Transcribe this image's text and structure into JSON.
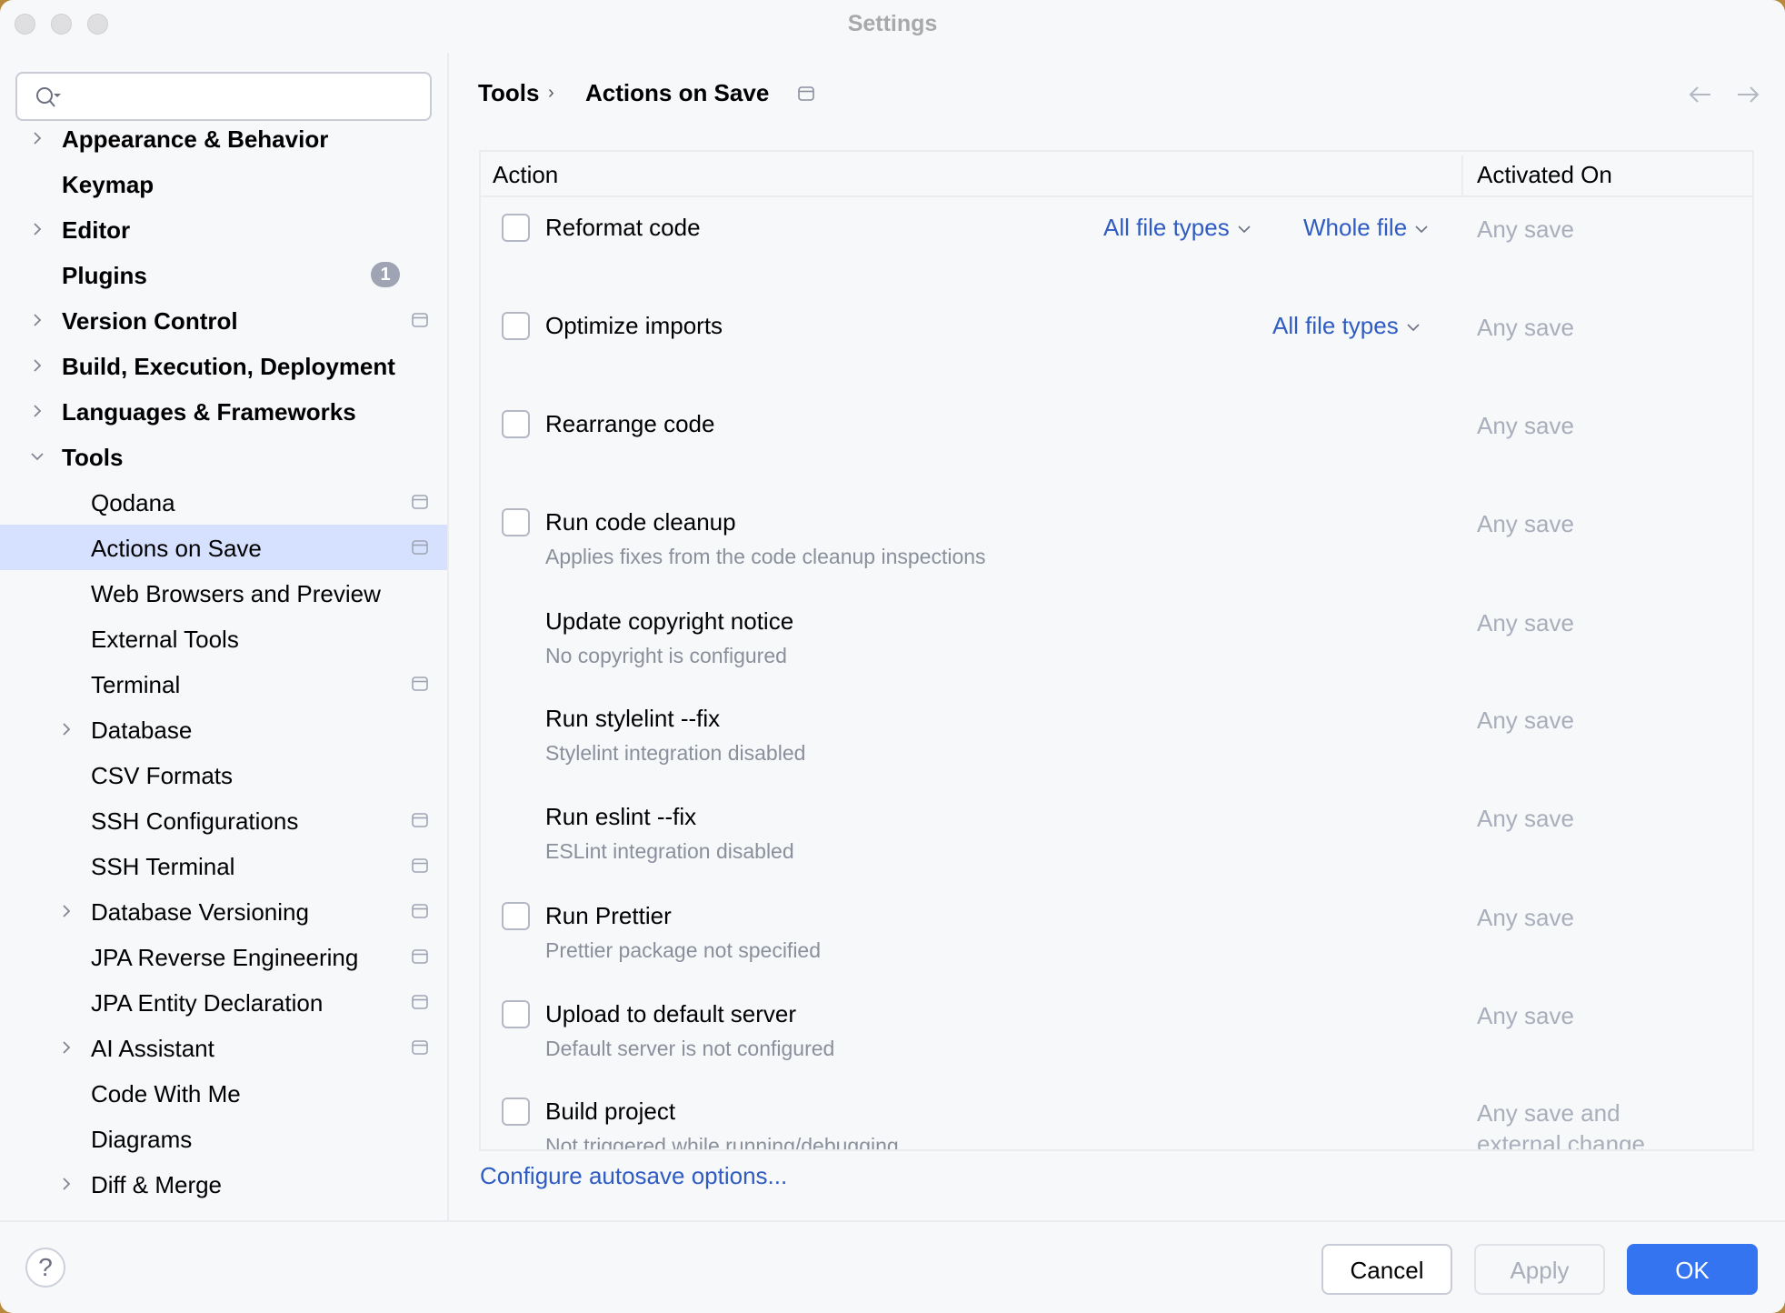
{
  "window": {
    "title": "Settings"
  },
  "search": {
    "placeholder": "",
    "value": ""
  },
  "sidebar": {
    "items": [
      {
        "label": "Appearance & Behavior",
        "level": 0,
        "bold": true,
        "chevron": "right",
        "badge": null,
        "project_icon": false,
        "selected": false
      },
      {
        "label": "Keymap",
        "level": 0,
        "bold": true,
        "chevron": null,
        "badge": null,
        "project_icon": false,
        "selected": false
      },
      {
        "label": "Editor",
        "level": 0,
        "bold": true,
        "chevron": "right",
        "badge": null,
        "project_icon": false,
        "selected": false
      },
      {
        "label": "Plugins",
        "level": 0,
        "bold": true,
        "chevron": null,
        "badge": "1",
        "project_icon": false,
        "selected": false
      },
      {
        "label": "Version Control",
        "level": 0,
        "bold": true,
        "chevron": "right",
        "badge": null,
        "project_icon": true,
        "selected": false
      },
      {
        "label": "Build, Execution, Deployment",
        "level": 0,
        "bold": true,
        "chevron": "right",
        "badge": null,
        "project_icon": false,
        "selected": false
      },
      {
        "label": "Languages & Frameworks",
        "level": 0,
        "bold": true,
        "chevron": "right",
        "badge": null,
        "project_icon": false,
        "selected": false
      },
      {
        "label": "Tools",
        "level": 0,
        "bold": true,
        "chevron": "down",
        "badge": null,
        "project_icon": false,
        "selected": false
      },
      {
        "label": "Qodana",
        "level": 1,
        "bold": false,
        "chevron": null,
        "badge": null,
        "project_icon": true,
        "selected": false
      },
      {
        "label": "Actions on Save",
        "level": 1,
        "bold": false,
        "chevron": null,
        "badge": null,
        "project_icon": true,
        "selected": true
      },
      {
        "label": "Web Browsers and Preview",
        "level": 1,
        "bold": false,
        "chevron": null,
        "badge": null,
        "project_icon": false,
        "selected": false
      },
      {
        "label": "External Tools",
        "level": 1,
        "bold": false,
        "chevron": null,
        "badge": null,
        "project_icon": false,
        "selected": false
      },
      {
        "label": "Terminal",
        "level": 1,
        "bold": false,
        "chevron": null,
        "badge": null,
        "project_icon": true,
        "selected": false
      },
      {
        "label": "Database",
        "level": 1,
        "bold": false,
        "chevron": "right",
        "badge": null,
        "project_icon": false,
        "selected": false
      },
      {
        "label": "CSV Formats",
        "level": 1,
        "bold": false,
        "chevron": null,
        "badge": null,
        "project_icon": false,
        "selected": false
      },
      {
        "label": "SSH Configurations",
        "level": 1,
        "bold": false,
        "chevron": null,
        "badge": null,
        "project_icon": true,
        "selected": false
      },
      {
        "label": "SSH Terminal",
        "level": 1,
        "bold": false,
        "chevron": null,
        "badge": null,
        "project_icon": true,
        "selected": false
      },
      {
        "label": "Database Versioning",
        "level": 1,
        "bold": false,
        "chevron": "right",
        "badge": null,
        "project_icon": true,
        "selected": false
      },
      {
        "label": "JPA Reverse Engineering",
        "level": 1,
        "bold": false,
        "chevron": null,
        "badge": null,
        "project_icon": true,
        "selected": false
      },
      {
        "label": "JPA Entity Declaration",
        "level": 1,
        "bold": false,
        "chevron": null,
        "badge": null,
        "project_icon": true,
        "selected": false
      },
      {
        "label": "AI Assistant",
        "level": 1,
        "bold": false,
        "chevron": "right",
        "badge": null,
        "project_icon": true,
        "selected": false
      },
      {
        "label": "Code With Me",
        "level": 1,
        "bold": false,
        "chevron": null,
        "badge": null,
        "project_icon": false,
        "selected": false
      },
      {
        "label": "Diagrams",
        "level": 1,
        "bold": false,
        "chevron": null,
        "badge": null,
        "project_icon": false,
        "selected": false
      },
      {
        "label": "Diff & Merge",
        "level": 1,
        "bold": false,
        "chevron": "right",
        "badge": null,
        "project_icon": false,
        "selected": false
      }
    ]
  },
  "breadcrumb": {
    "parent": "Tools",
    "separator": "›",
    "current": "Actions on Save"
  },
  "table": {
    "columns": [
      "Action",
      "Activated On"
    ],
    "rows": [
      {
        "label": "Reformat code",
        "subtitle": "",
        "checkbox": true,
        "checked": false,
        "dropdowns": [
          "All file types",
          "Whole file"
        ],
        "activated_on": "Any save"
      },
      {
        "label": "Optimize imports",
        "subtitle": "",
        "checkbox": true,
        "checked": false,
        "dropdowns": [
          "All file types"
        ],
        "activated_on": "Any save"
      },
      {
        "label": "Rearrange code",
        "subtitle": "",
        "checkbox": true,
        "checked": false,
        "dropdowns": [],
        "activated_on": "Any save"
      },
      {
        "label": "Run code cleanup",
        "subtitle": "Applies fixes from the code cleanup inspections",
        "checkbox": true,
        "checked": false,
        "dropdowns": [],
        "activated_on": "Any save"
      },
      {
        "label": "Update copyright notice",
        "subtitle": "No copyright is configured",
        "checkbox": false,
        "checked": false,
        "dropdowns": [],
        "activated_on": "Any save"
      },
      {
        "label": "Run stylelint --fix",
        "subtitle": "Stylelint integration disabled",
        "checkbox": false,
        "checked": false,
        "dropdowns": [],
        "activated_on": "Any save"
      },
      {
        "label": "Run eslint --fix",
        "subtitle": "ESLint integration disabled",
        "checkbox": false,
        "checked": false,
        "dropdowns": [],
        "activated_on": "Any save"
      },
      {
        "label": "Run Prettier",
        "subtitle": "Prettier package not specified",
        "checkbox": true,
        "checked": false,
        "dropdowns": [],
        "activated_on": "Any save"
      },
      {
        "label": "Upload to default server",
        "subtitle": "Default server is not configured",
        "checkbox": true,
        "checked": false,
        "dropdowns": [],
        "activated_on": "Any save"
      },
      {
        "label": "Build project",
        "subtitle": "Not triggered while running/debugging",
        "checkbox": true,
        "checked": false,
        "dropdowns": [],
        "activated_on": "Any save and external change"
      }
    ]
  },
  "link": {
    "configure_autosave": "Configure autosave options..."
  },
  "footer": {
    "help": "?",
    "cancel": "Cancel",
    "apply": "Apply",
    "ok": "OK"
  },
  "colors": {
    "accent": "#3574f0",
    "link": "#2f5cc3",
    "selection": "#d5e1ff",
    "muted": "#a9aebb"
  }
}
